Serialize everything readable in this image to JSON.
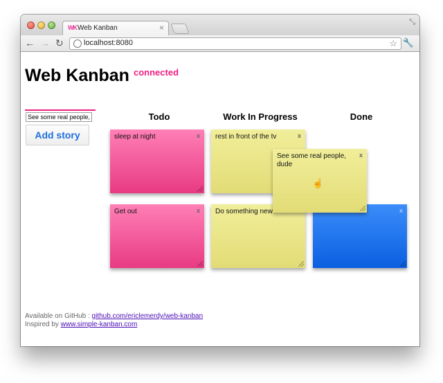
{
  "browser": {
    "tab_logo": "WK",
    "tab_title": "Web Kanban",
    "tab_close": "×",
    "url": "localhost:8080"
  },
  "page": {
    "title": "Web Kanban",
    "status": "connected",
    "status_color": "#ee1f82",
    "input_value": "See some real people,",
    "add_button": "Add story"
  },
  "board": {
    "columns": [
      "Todo",
      "Work In Progress",
      "Done"
    ],
    "cards": [
      {
        "text": "sleep at night",
        "color": "pink"
      },
      {
        "text": "rest in front of the tv",
        "color": "yellow"
      },
      {
        "text": "Get out",
        "color": "pink"
      },
      {
        "text": "Do something new",
        "color": "yellow"
      },
      {
        "text": "",
        "color": "blue"
      },
      {
        "text": "See some real people, dude",
        "color": "yellow",
        "state": "dragging"
      }
    ],
    "close_glyph": "x"
  },
  "footer": {
    "github_prefix": "Available on GitHub : ",
    "github_link": "github.com/ericlemerdy/web-kanban",
    "inspired_prefix": "Inspired by ",
    "inspired_link": "www.simple-kanban.com"
  },
  "icons": [
    "back-icon",
    "forward-icon",
    "reload-icon",
    "globe-icon",
    "star-icon",
    "wrench-icon",
    "hand-cursor-icon"
  ]
}
